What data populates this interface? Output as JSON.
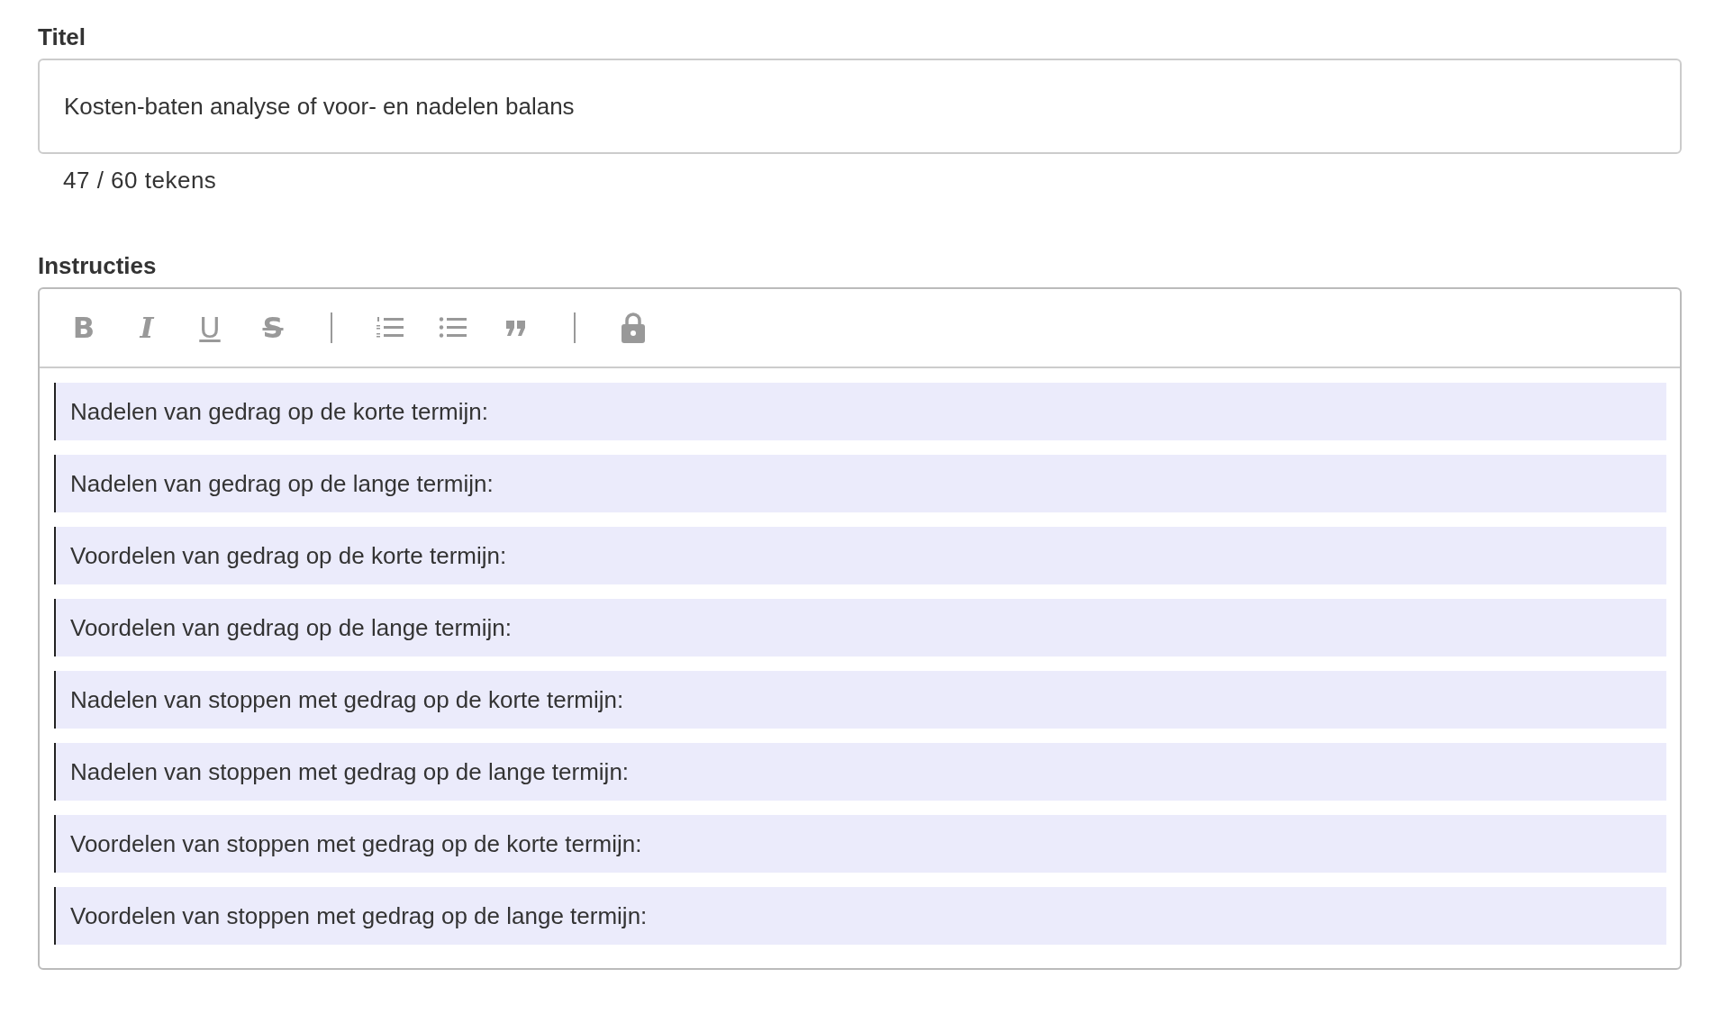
{
  "title_field": {
    "label": "Titel",
    "value": "Kosten-baten analyse of voor- en nadelen balans",
    "counter": "47 / 60 tekens"
  },
  "instructions": {
    "label": "Instructies",
    "toolbar": [
      {
        "kind": "bold",
        "label": "B"
      },
      {
        "kind": "italic",
        "label": "I"
      },
      {
        "kind": "underline",
        "label": "U"
      },
      {
        "kind": "strike",
        "label": "S"
      },
      {
        "kind": "separator"
      },
      {
        "kind": "ordered-list"
      },
      {
        "kind": "bullet-list"
      },
      {
        "kind": "quote"
      },
      {
        "kind": "separator"
      },
      {
        "kind": "lock"
      }
    ],
    "blocks": [
      "Nadelen van gedrag op de korte termijn:",
      "Nadelen van gedrag op de lange termijn:",
      "Voordelen van gedrag op de korte termijn:",
      "Voordelen van gedrag op de lange termijn:",
      "Nadelen van stoppen met gedrag op de korte termijn:",
      "Nadelen van stoppen met gedrag op de lange termijn:",
      "Voordelen van stoppen met gedrag op de korte termijn:",
      "Voordelen van stoppen met gedrag op de lange termijn:"
    ]
  }
}
